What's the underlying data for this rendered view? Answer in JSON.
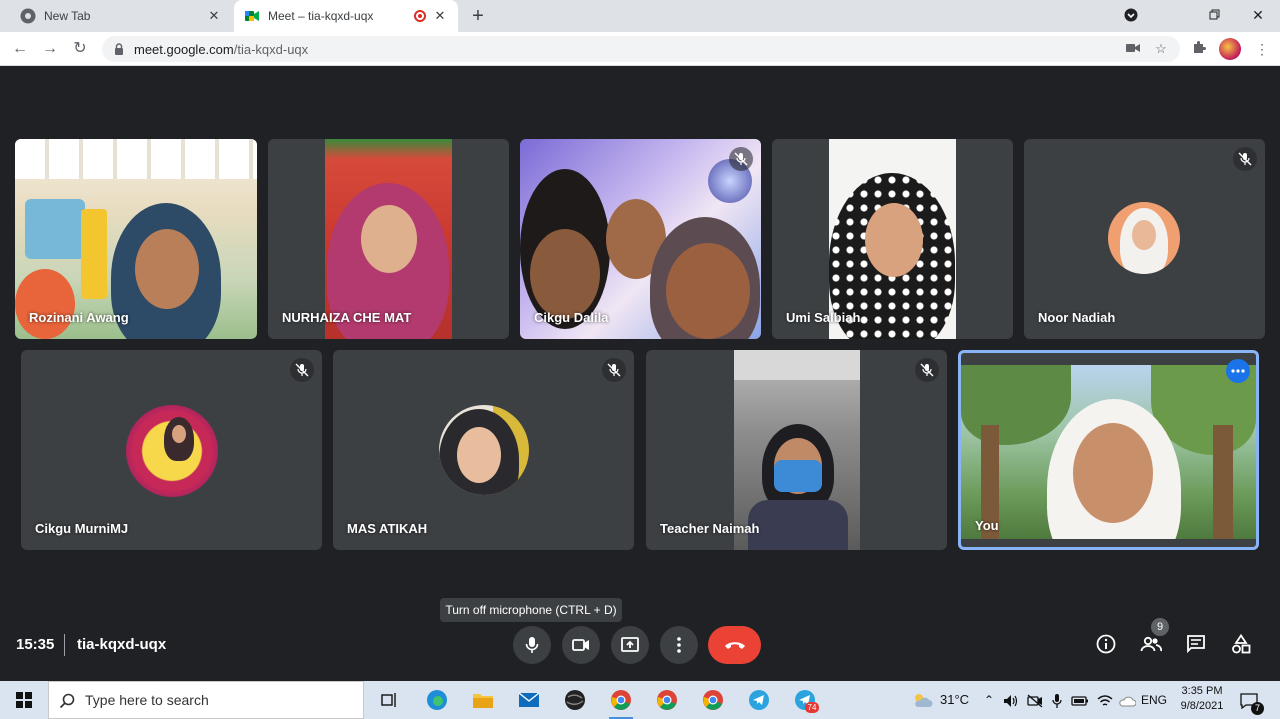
{
  "browser": {
    "tabs": [
      {
        "title": "New Tab",
        "icon": "chrome-icon",
        "active": false
      },
      {
        "title": "Meet – tia-kqxd-uqx",
        "icon": "meet-icon",
        "active": true,
        "recording": true
      }
    ],
    "new_tab_glyph": "+",
    "url_host": "meet.google.com",
    "url_path": "/tia-kqxd-uqx"
  },
  "participants_row1": [
    {
      "name": "Rozinani Awang",
      "muted": false
    },
    {
      "name": "NURHAIZA CHE MAT",
      "muted": false
    },
    {
      "name": "Cikgu Dalila",
      "muted": true
    },
    {
      "name": "Umi Salbiah",
      "muted": false
    },
    {
      "name": "Noor Nadiah",
      "muted": true
    }
  ],
  "participants_row2": [
    {
      "name": "Cikgu MurniMJ",
      "muted": true
    },
    {
      "name": "MAS ATIKAH",
      "muted": true
    },
    {
      "name": "Teacher Naimah",
      "muted": true
    },
    {
      "name": "You",
      "muted": false,
      "self": true
    }
  ],
  "tooltip": "Turn off microphone (CTRL + D)",
  "meeting": {
    "time": "15:35",
    "code": "tia-kqxd-uqx",
    "participant_count": "9"
  },
  "taskbar": {
    "search_placeholder": "Type here to search",
    "weather": "31°C",
    "language": "ENG",
    "time": "3:35 PM",
    "date": "9/8/2021",
    "notification_count": "7",
    "telegram_badge": "74"
  },
  "colors": {
    "hangup": "#ea4335",
    "accent": "#8ab4f8",
    "tile_bg": "#3c4043",
    "meet_bg": "#202124"
  }
}
